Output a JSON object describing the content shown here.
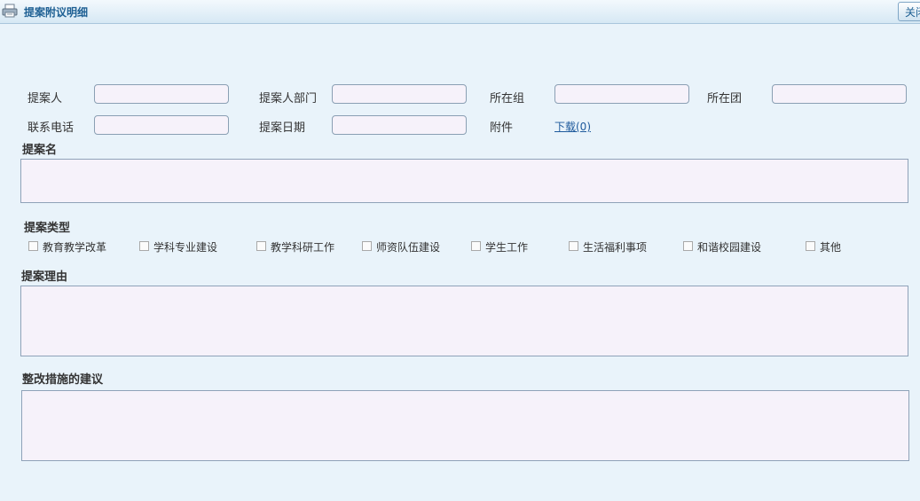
{
  "window": {
    "title": "提案附议明细",
    "close_label": "关闭"
  },
  "form": {
    "proposer_label": "提案人",
    "proposer_dept_label": "提案人部门",
    "group_label": "所在组",
    "team_label": "所在团",
    "phone_label": "联系电话",
    "date_label": "提案日期",
    "attachment_label": "附件",
    "attachment_link": "下载(0)",
    "proposer_value": "",
    "proposer_dept_value": "",
    "group_value": "",
    "team_value": "",
    "phone_value": "",
    "date_value": ""
  },
  "sections": {
    "name_title": "提案名",
    "type_title": "提案类型",
    "reason_title": "提案理由",
    "suggestion_title": "整改措施的建议"
  },
  "proposal_types": [
    {
      "label": "教育教学改革",
      "checked": false
    },
    {
      "label": "学科专业建设",
      "checked": false
    },
    {
      "label": "教学科研工作",
      "checked": false
    },
    {
      "label": "师资队伍建设",
      "checked": false
    },
    {
      "label": "学生工作",
      "checked": false
    },
    {
      "label": "生活福利事项",
      "checked": false
    },
    {
      "label": "和谐校园建设",
      "checked": false
    },
    {
      "label": "其他",
      "checked": false
    }
  ]
}
